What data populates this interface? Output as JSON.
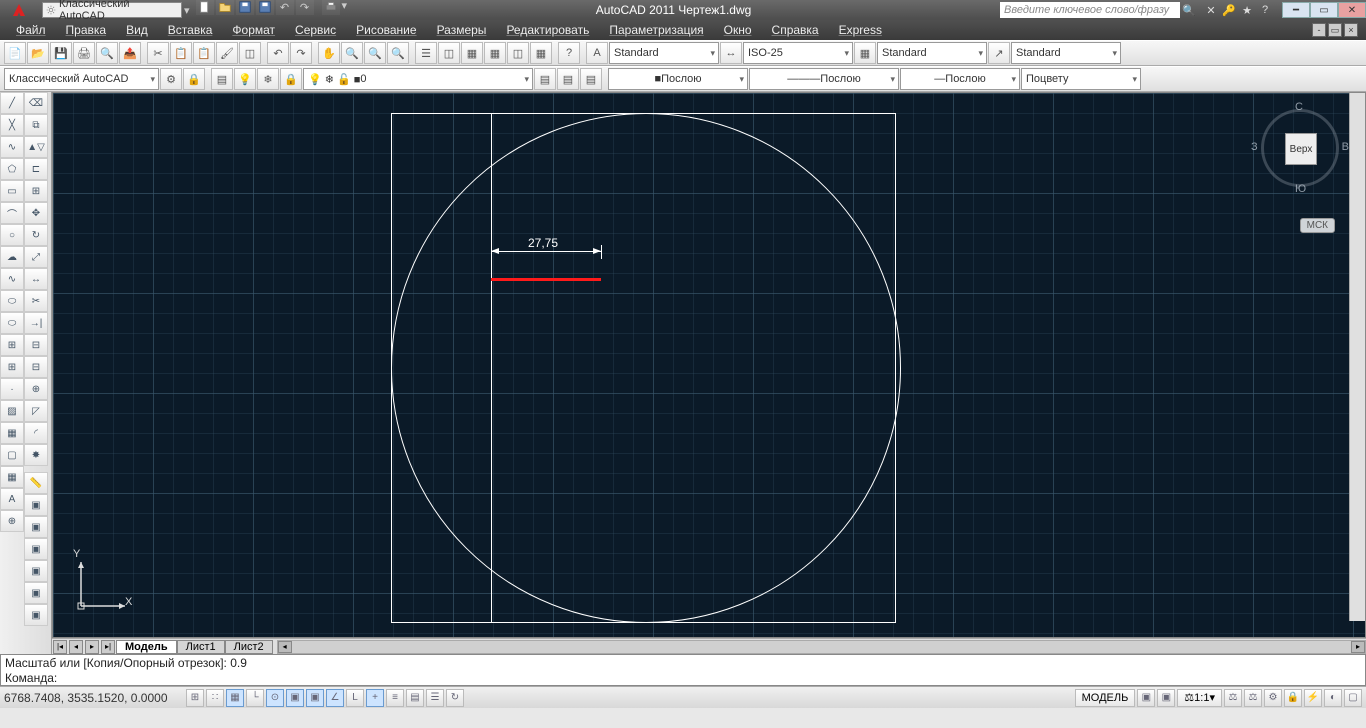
{
  "titlebar": {
    "workspace": "Классический AutoCAD",
    "title": "AutoCAD 2011   Чертеж1.dwg",
    "search_placeholder": "Введите ключевое слово/фразу"
  },
  "menu": {
    "items": [
      "Файл",
      "Правка",
      "Вид",
      "Вставка",
      "Формат",
      "Сервис",
      "Рисование",
      "Размеры",
      "Редактировать",
      "Параметризация",
      "Окно",
      "Справка",
      "Express"
    ]
  },
  "props_row": {
    "text_style": "Standard",
    "dim_style": "ISO-25",
    "table_style": "Standard",
    "mleader_style": "Standard"
  },
  "layer_row": {
    "workspace": "Классический AutoCAD",
    "layer": "0",
    "color_sel": "Послою",
    "linetype_sel": "Послою",
    "lineweight_sel": "Послою",
    "plotstyle_sel": "Поцвету"
  },
  "drawing": {
    "dimension_value": "27,75"
  },
  "viewcube": {
    "top": "С",
    "bottom": "Ю",
    "left": "З",
    "right": "В",
    "face": "Верх",
    "mck": "МСК"
  },
  "tabs": {
    "model": "Модель",
    "sheet1": "Лист1",
    "sheet2": "Лист2"
  },
  "cmdline": {
    "line1": "Масштаб или [Копия/Опорный отрезок]: 0.9",
    "line2": "Команда:"
  },
  "status": {
    "coords": "6768.7408, 3535.1520, 0.0000",
    "model": "МОДЕЛЬ",
    "scale": "1:1"
  },
  "ucs": {
    "x": "X",
    "y": "Y"
  }
}
